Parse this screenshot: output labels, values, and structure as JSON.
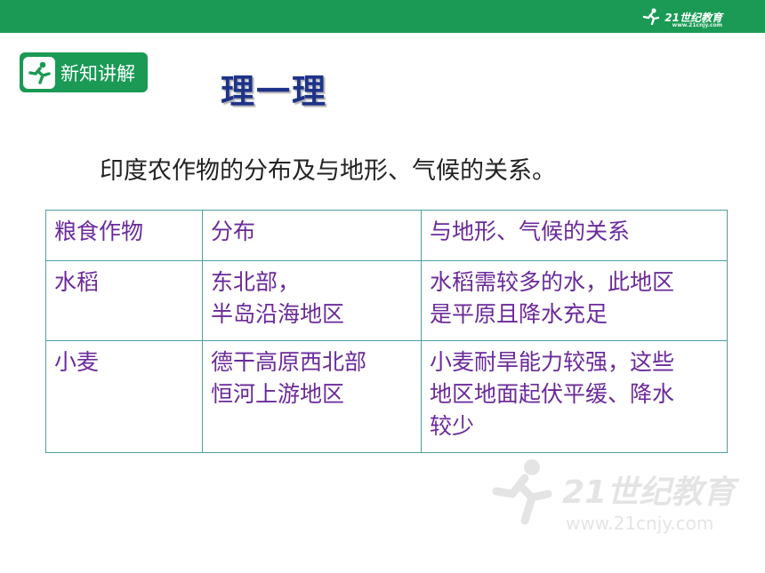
{
  "header": {
    "logo_text": "21世纪教育",
    "logo_url": "www.21cnjy.com"
  },
  "badge": {
    "label": "新知讲解"
  },
  "page": {
    "title": "理一理",
    "subtitle": "印度农作物的分布及与地形、气候的关系。"
  },
  "table": {
    "headers": [
      "粮食作物",
      "分布",
      "与地形、气候的关系"
    ],
    "rows": [
      {
        "crop": "水稻",
        "distribution": [
          "东北部，",
          "半岛沿海地区"
        ],
        "relation": [
          "水稻需较多的水，此地区",
          "是平原且降水充足"
        ]
      },
      {
        "crop": "小麦",
        "distribution": [
          "德干高原西北部",
          "恒河上游地区"
        ],
        "relation": [
          "小麦耐旱能力较强，这些",
          "地区地面起伏平缓、降水",
          "较少"
        ]
      }
    ]
  },
  "watermark": {
    "text": "21世纪教育",
    "url": "www.21cnjy.com"
  },
  "colors": {
    "brand_green": "#1a9a55",
    "title_blue": "#1e3388",
    "table_text": "#6b2a9a",
    "table_border": "#4f9ea0"
  },
  "icons": [
    "runner-logo-icon",
    "badge-runner-icon"
  ]
}
